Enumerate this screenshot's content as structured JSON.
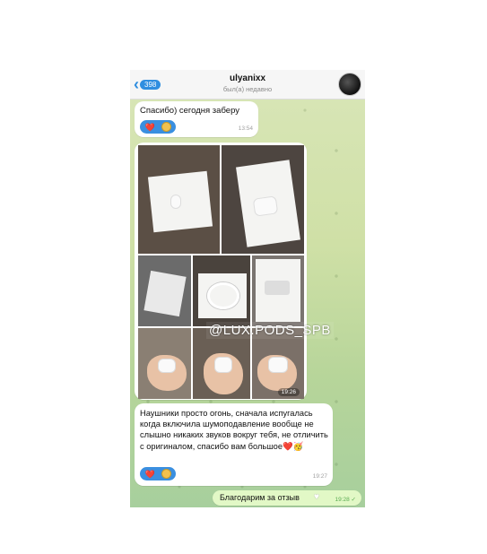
{
  "header": {
    "back_count": "398",
    "title": "ulyanixx",
    "status": "был(а) недавно"
  },
  "messages": [
    {
      "text": "Спасибо) сегодня заберу",
      "time": "13:54",
      "reactions": [
        "❤️",
        "emoji-face"
      ]
    },
    {
      "type": "photo-album",
      "watermark": "@LUX.PODS_SPB",
      "time": "19:26"
    },
    {
      "text": "Наушники просто огонь, сначала испугалась когда включила шумоподавление вообще не слышно никаких звуков вокруг тебя, не отличить с оригиналом, спасибо вам большое❤️🥳",
      "time": "19:27",
      "reactions": [
        "❤️",
        "emoji-face"
      ]
    },
    {
      "text": "Благодарим за отзыв",
      "time": "19:28",
      "outgoing": true
    }
  ],
  "colors": {
    "accent": "#2f8ee0",
    "outgoing_bubble": "#e2f8c6",
    "chat_bg": "#cfe0a6"
  }
}
